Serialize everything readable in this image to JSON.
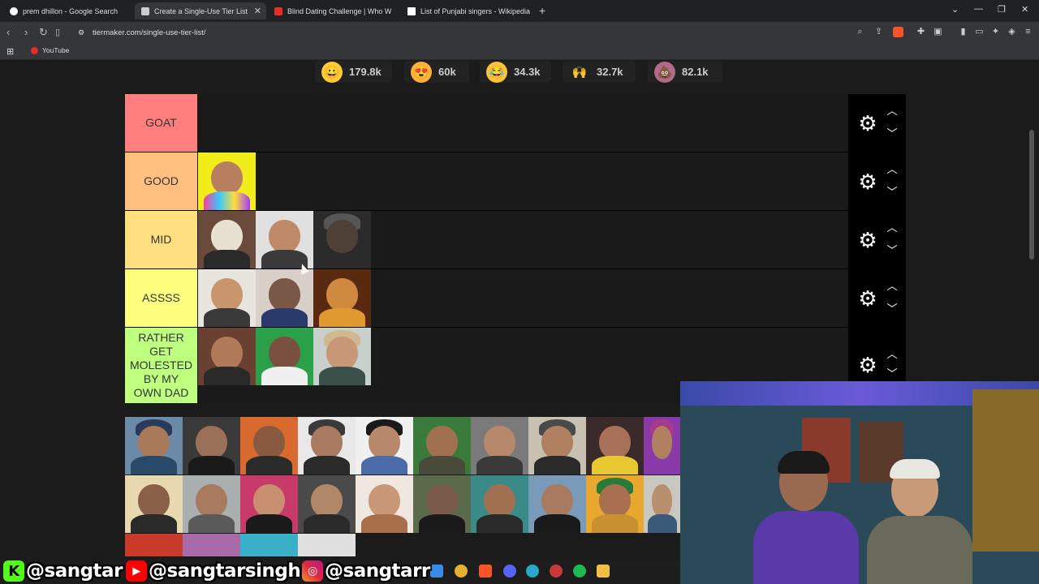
{
  "browser": {
    "tabs": [
      {
        "title": "prem dhillon - Google Search",
        "icon": "google-icon",
        "color": "#ffffff"
      },
      {
        "title": "Create a Single-Use Tier List (Pri",
        "icon": "tiermaker-icon",
        "color": "#e0e0e0"
      },
      {
        "title": "Blind Dating Challenge | Who Will K",
        "icon": "youtube-icon",
        "color": "#e52d27"
      },
      {
        "title": "List of Punjabi singers - Wikipedia",
        "icon": "wikipedia-icon",
        "color": "#ffffff"
      }
    ],
    "url": "tiermaker.com/single-use-tier-list/",
    "bookmark": "YouTube"
  },
  "reactions": [
    {
      "icon": "grin-emoji",
      "count": "179.8k",
      "color": "#ffca3a"
    },
    {
      "icon": "heart-eyes-emoji",
      "count": "60k",
      "color": "#ffb03a"
    },
    {
      "icon": "laugh-emoji",
      "count": "34.3k",
      "color": "#ffc23a"
    },
    {
      "icon": "raised-hands-emoji",
      "count": "32.7k",
      "color": "#ffb300"
    },
    {
      "icon": "poop-emoji",
      "count": "82.1k",
      "color": "#b06a8a"
    }
  ],
  "tiers": [
    {
      "label": "GOAT",
      "color": "#ff7f7f"
    },
    {
      "label": "GOOD",
      "color": "#ffbf7f"
    },
    {
      "label": "MID",
      "color": "#ffdf7f"
    },
    {
      "label": "ASSSS",
      "color": "#ffff7f"
    },
    {
      "label": "RATHER GET MOLESTED BY MY OWN DAD",
      "color": "#bfff7f"
    }
  ],
  "social": {
    "kick": "@sangtar",
    "youtube": "@sangtarsingh",
    "instagram": "@sangtarr"
  }
}
